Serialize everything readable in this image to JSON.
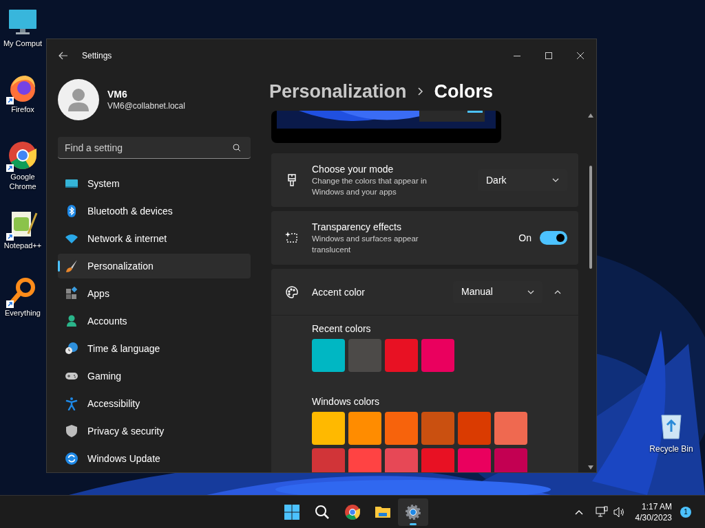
{
  "desktop_icons": [
    {
      "label": "My Comput",
      "kind": "computer",
      "shortcut": false
    },
    {
      "label": "Firefox",
      "kind": "firefox",
      "shortcut": true
    },
    {
      "label": "Google Chrome",
      "kind": "chrome",
      "shortcut": true
    },
    {
      "label": "Notepad++",
      "kind": "notepad",
      "shortcut": true
    },
    {
      "label": "Everything",
      "kind": "everything",
      "shortcut": true
    }
  ],
  "recycle_bin": {
    "label": "Recycle Bin"
  },
  "window": {
    "title": "Settings"
  },
  "account": {
    "name": "VM6",
    "email": "VM6@collabnet.local"
  },
  "search": {
    "placeholder": "Find a setting"
  },
  "nav": [
    {
      "label": "System",
      "kind": "system",
      "selected": false
    },
    {
      "label": "Bluetooth & devices",
      "kind": "bluetooth",
      "selected": false
    },
    {
      "label": "Network & internet",
      "kind": "network",
      "selected": false
    },
    {
      "label": "Personalization",
      "kind": "brush",
      "selected": true
    },
    {
      "label": "Apps",
      "kind": "apps",
      "selected": false
    },
    {
      "label": "Accounts",
      "kind": "accounts",
      "selected": false
    },
    {
      "label": "Time & language",
      "kind": "time",
      "selected": false
    },
    {
      "label": "Gaming",
      "kind": "gaming",
      "selected": false
    },
    {
      "label": "Accessibility",
      "kind": "accessibility",
      "selected": false
    },
    {
      "label": "Privacy & security",
      "kind": "privacy",
      "selected": false
    },
    {
      "label": "Windows Update",
      "kind": "update",
      "selected": false
    }
  ],
  "breadcrumb": [
    "Personalization",
    "Colors"
  ],
  "settings": [
    {
      "kind": "dropdown",
      "title": "Choose your mode",
      "description": "Change the colors that appear in Windows and your apps",
      "value": "Dark"
    },
    {
      "kind": "toggle",
      "title": "Transparency effects",
      "description": "Windows and surfaces appear translucent",
      "state_label": "On",
      "on": true
    },
    {
      "kind": "accent",
      "title": "Accent color",
      "value": "Manual",
      "expanded": true
    }
  ],
  "recent_colors": {
    "title": "Recent colors",
    "swatches": [
      {
        "color": "#00b7c3"
      },
      {
        "color": "#4c4a48"
      },
      {
        "color": "#e81123"
      },
      {
        "color": "#ea005e"
      }
    ]
  },
  "windows_colors": {
    "title": "Windows colors",
    "swatches": [
      {
        "color": "#ffb900"
      },
      {
        "color": "#ff8c00"
      },
      {
        "color": "#f7630c"
      },
      {
        "color": "#ca5010"
      },
      {
        "color": "#da3b01"
      },
      {
        "color": "#ef6950"
      },
      {
        "color": "#d13438"
      },
      {
        "color": "#ff4343"
      },
      {
        "color": "#e74856"
      },
      {
        "color": "#e81123"
      },
      {
        "color": "#ea005e"
      },
      {
        "color": "#c30052"
      }
    ]
  },
  "taskbar": {
    "apps": [
      {
        "kind": "start",
        "selected": false
      },
      {
        "kind": "search",
        "selected": false
      },
      {
        "kind": "chrome",
        "selected": false
      },
      {
        "kind": "explorer",
        "selected": false
      },
      {
        "kind": "settings",
        "selected": true
      }
    ],
    "time": "1:17 AM",
    "date": "4/30/2023",
    "notification_count": "1"
  }
}
